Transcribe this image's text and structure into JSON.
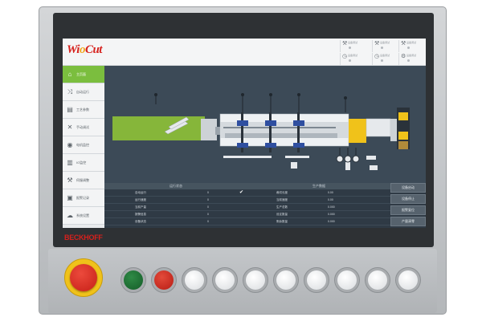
{
  "app": {
    "logo_prefix": "Wi",
    "logo_mid": "o",
    "logo_suffix": "Cut"
  },
  "brand": "BECKHOFF",
  "top_buttons": [
    {
      "icon": "wrench-icon",
      "label": "设备调试"
    },
    {
      "icon": "wrench-icon",
      "label": "设备调试"
    },
    {
      "icon": "wrench-icon",
      "label": "设备调试"
    },
    {
      "icon": "clock-icon",
      "label": "设备调试"
    },
    {
      "icon": "clock-icon",
      "label": "设备调试"
    },
    {
      "icon": "gear-icon",
      "label": "设备调试"
    }
  ],
  "sidebar": {
    "active_index": 0,
    "items": [
      {
        "icon": "home-icon",
        "label": "主页面"
      },
      {
        "icon": "shuffle-icon",
        "label": "自动运行"
      },
      {
        "icon": "list-icon",
        "label": "工艺参数"
      },
      {
        "icon": "tools-icon",
        "label": "手动调试"
      },
      {
        "icon": "gauge-icon",
        "label": "电机监控"
      },
      {
        "icon": "chart-icon",
        "label": "IO监控"
      },
      {
        "icon": "wrench-icon",
        "label": "伺服调整"
      },
      {
        "icon": "log-icon",
        "label": "报警记录"
      },
      {
        "icon": "cloud-icon",
        "label": "系统设置"
      },
      {
        "icon": "user-icon",
        "label": "用户管理"
      }
    ]
  },
  "left_table": {
    "header": "运行状态",
    "rows": [
      {
        "name": "自动运行",
        "value": "0"
      },
      {
        "name": "运行速度",
        "value": "0"
      },
      {
        "name": "当前产量",
        "value": "0"
      },
      {
        "name": "报警信息",
        "value": "0"
      },
      {
        "name": "设备状态",
        "value": "0"
      }
    ]
  },
  "right_table": {
    "header": "生产数据",
    "rows": [
      {
        "name": "裁切长度",
        "value": "0.00"
      },
      {
        "name": "当前速度",
        "value": "0.00"
      },
      {
        "name": "生产总数",
        "value": "0.000"
      },
      {
        "name": "设定数量",
        "value": "0.000"
      },
      {
        "name": "剩余数量",
        "value": "0.000"
      }
    ]
  },
  "right_buttons": [
    {
      "label": "设备启动"
    },
    {
      "label": "设备停止"
    },
    {
      "label": "报警复位"
    },
    {
      "label": "产量清零"
    }
  ],
  "colors": {
    "accent": "#7bbe3e",
    "brand": "#d6201c",
    "screen_bg": "#3c4a57",
    "estop": "#d42a1f"
  }
}
